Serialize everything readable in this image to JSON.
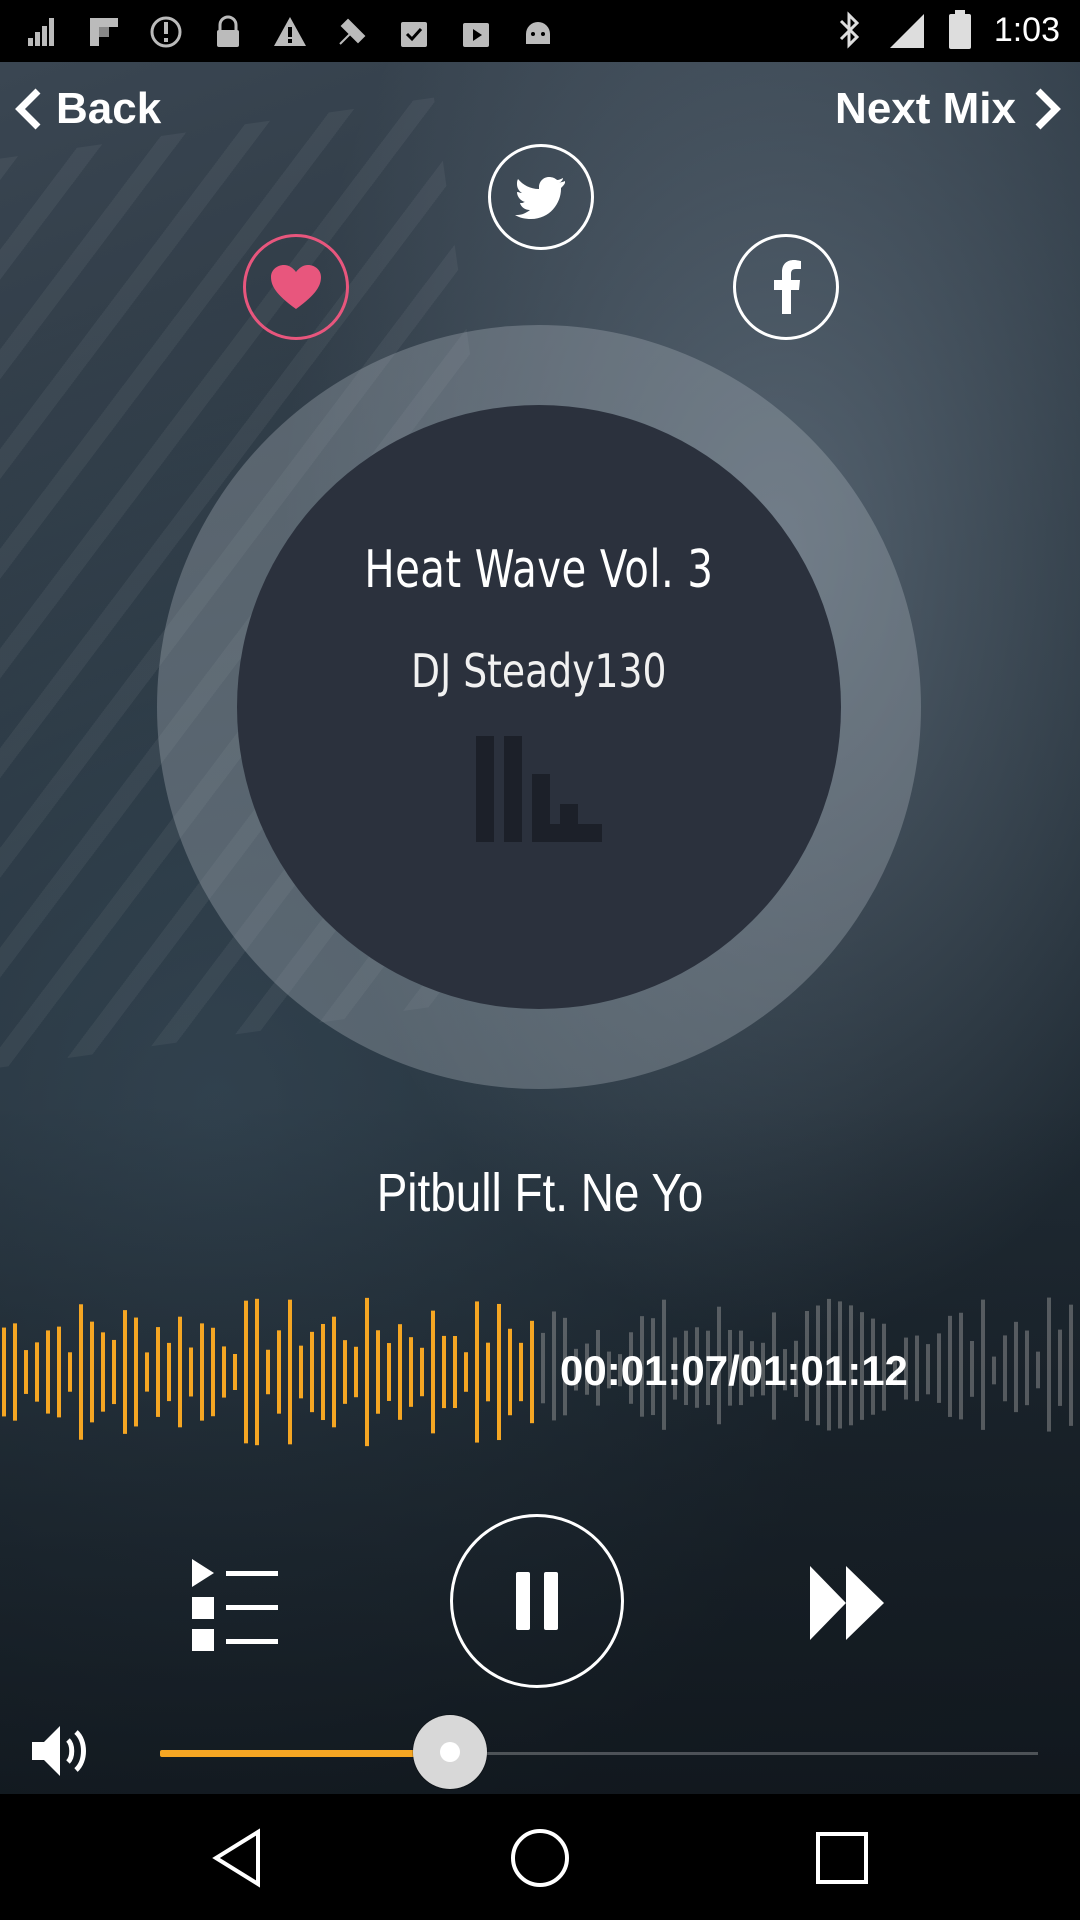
{
  "status_bar": {
    "time": "1:03",
    "icons": [
      "signal-icon",
      "flipboard-icon",
      "data-saver-icon",
      "lock-icon",
      "warning-icon",
      "fake-gps-icon",
      "clipboard-check-icon",
      "play-store-icon",
      "android-icon"
    ]
  },
  "nav": {
    "back_label": "Back",
    "next_label": "Next Mix"
  },
  "social": {
    "like_icon": "heart-icon",
    "twitter_icon": "twitter-icon",
    "facebook_icon": "facebook-icon"
  },
  "mix": {
    "title": "Heat Wave Vol. 3",
    "artist": "DJ Steady130"
  },
  "track": {
    "name": "Pitbull Ft. Ne Yo",
    "time": "00:01:07/01:01:12",
    "progress": 0.5
  },
  "volume": {
    "level": 0.33
  },
  "colors": {
    "accent": "#f5a623",
    "like": "#e8567d",
    "disc": "#2b313d"
  }
}
